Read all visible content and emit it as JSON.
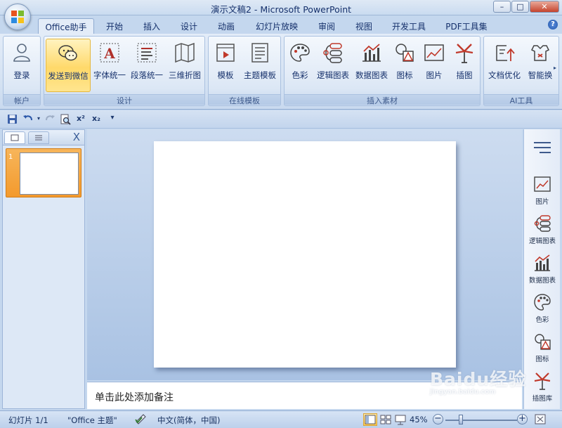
{
  "window": {
    "title": "演示文稿2 - Microsoft PowerPoint",
    "controls": {
      "minimize": "–",
      "maximize": "□",
      "close": "✕"
    }
  },
  "ribbon": {
    "tabs": [
      {
        "label": "Office助手",
        "active": true
      },
      {
        "label": "开始"
      },
      {
        "label": "插入"
      },
      {
        "label": "设计"
      },
      {
        "label": "动画"
      },
      {
        "label": "幻灯片放映"
      },
      {
        "label": "审阅"
      },
      {
        "label": "视图"
      },
      {
        "label": "开发工具"
      },
      {
        "label": "PDF工具集"
      }
    ],
    "help": "?",
    "groups": {
      "account": {
        "label": "帐户",
        "buttons": [
          {
            "label": "登录",
            "icon": "user-icon"
          }
        ]
      },
      "design": {
        "label": "设计",
        "buttons": [
          {
            "label": "发送到微信",
            "icon": "wechat-icon"
          },
          {
            "label": "字体统一",
            "icon": "font-unify-icon"
          },
          {
            "label": "段落统一",
            "icon": "paragraph-unify-icon"
          },
          {
            "label": "三维折图",
            "icon": "3d-fold-icon"
          }
        ]
      },
      "online_templates": {
        "label": "在线模板",
        "buttons": [
          {
            "label": "模板",
            "icon": "template-icon"
          },
          {
            "label": "主题模板",
            "icon": "theme-template-icon"
          }
        ]
      },
      "insert_assets": {
        "label": "插入素材",
        "buttons": [
          {
            "label": "色彩",
            "icon": "palette-icon"
          },
          {
            "label": "逻辑图表",
            "icon": "logic-chart-icon"
          },
          {
            "label": "数据图表",
            "icon": "data-chart-icon"
          },
          {
            "label": "图标",
            "icon": "shapes-icon"
          },
          {
            "label": "图片",
            "icon": "picture-icon"
          },
          {
            "label": "插图",
            "icon": "illustration-icon"
          }
        ]
      },
      "ai_tools": {
        "label": "AI工具",
        "buttons": [
          {
            "label": "文档优化",
            "icon": "doc-optimize-icon"
          },
          {
            "label": "智能换",
            "icon": "smart-swap-icon"
          }
        ]
      }
    }
  },
  "quick_access": {
    "superscript": "x²",
    "subscript": "x₂",
    "dropdown": "▾"
  },
  "slides_pane": {
    "close": "X",
    "thumbnails": [
      {
        "number": "1"
      }
    ]
  },
  "notes": {
    "placeholder": "单击此处添加备注"
  },
  "right_panel": {
    "items": [
      {
        "label": "图片",
        "icon": "picture-icon"
      },
      {
        "label": "逻辑图表",
        "icon": "logic-chart-icon"
      },
      {
        "label": "数据图表",
        "icon": "data-chart-icon"
      },
      {
        "label": "色彩",
        "icon": "palette-icon"
      },
      {
        "label": "图标",
        "icon": "shapes-icon"
      },
      {
        "label": "插图库",
        "icon": "illustration-icon"
      }
    ]
  },
  "status_bar": {
    "slide_info": "幻灯片 1/1",
    "theme": "\"Office 主题\"",
    "language": "中文(简体，中国)",
    "zoom": "45%",
    "zoom_out": "−",
    "zoom_in": "+"
  },
  "watermark": {
    "text": "Baidu经验",
    "sub": "jingyan.baidu.com"
  },
  "colors": {
    "accent": "#f39a2d",
    "ribbon": "#dce7f5",
    "highlight": "#ffd96a"
  }
}
